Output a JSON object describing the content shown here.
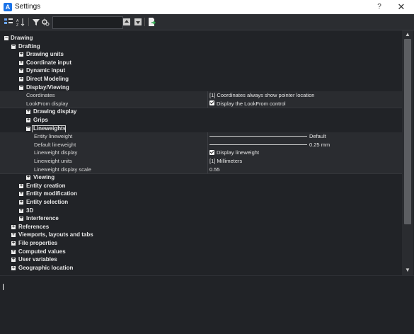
{
  "window": {
    "title": "Settings",
    "help": "?",
    "close": "✕",
    "app_icon": "A"
  },
  "toolbar": {
    "search_placeholder": ""
  },
  "tree": [
    {
      "label": "Drawing",
      "level": 0,
      "exp": "-"
    },
    {
      "label": "Drafting",
      "level": 1,
      "exp": "-"
    },
    {
      "label": "Drawing units",
      "level": 2,
      "exp": "+"
    },
    {
      "label": "Coordinate input",
      "level": 2,
      "exp": "+"
    },
    {
      "label": "Dynamic input",
      "level": 2,
      "exp": "+"
    },
    {
      "label": "Direct Modeling",
      "level": 2,
      "exp": "+"
    },
    {
      "label": "Display/Viewing",
      "level": 2,
      "exp": "-"
    }
  ],
  "display_props": {
    "coordinates_label": "Coordinates",
    "coordinates_value": "[1] Coordinates always show pointer location",
    "lookfrom_label": "LookFrom display",
    "lookfrom_value": "Display the LookFrom control"
  },
  "sub_tree": {
    "drawing_display": "Drawing display",
    "grips": "Grips",
    "lineweights": "Lineweights"
  },
  "lineweight_props": {
    "entity_lw_label": "Entity lineweight",
    "entity_lw_value": "Default",
    "default_lw_label": "Default lineweight",
    "default_lw_value": "0.25 mm",
    "lw_display_label": "Lineweight display",
    "lw_display_value": "Display lineweight",
    "lw_units_label": "Lineweight units",
    "lw_units_value": "[1] Millimeters",
    "lw_scale_label": "Lineweight display scale",
    "lw_scale_value": "0.55"
  },
  "tree_after": [
    {
      "label": "Viewing",
      "level": 3
    },
    {
      "label": "Entity creation",
      "level": 2
    },
    {
      "label": "Entity modification",
      "level": 2
    },
    {
      "label": "Entity selection",
      "level": 2
    },
    {
      "label": "3D",
      "level": 2
    },
    {
      "label": "Interference",
      "level": 2
    },
    {
      "label": "References",
      "level": 1
    },
    {
      "label": "Viewports, layouts and tabs",
      "level": 1
    },
    {
      "label": "File properties",
      "level": 1
    },
    {
      "label": "Computed values",
      "level": 1
    },
    {
      "label": "User variables",
      "level": 1
    },
    {
      "label": "Geographic location",
      "level": 1
    }
  ],
  "scroll": {
    "up": "▲",
    "down": "▼"
  }
}
